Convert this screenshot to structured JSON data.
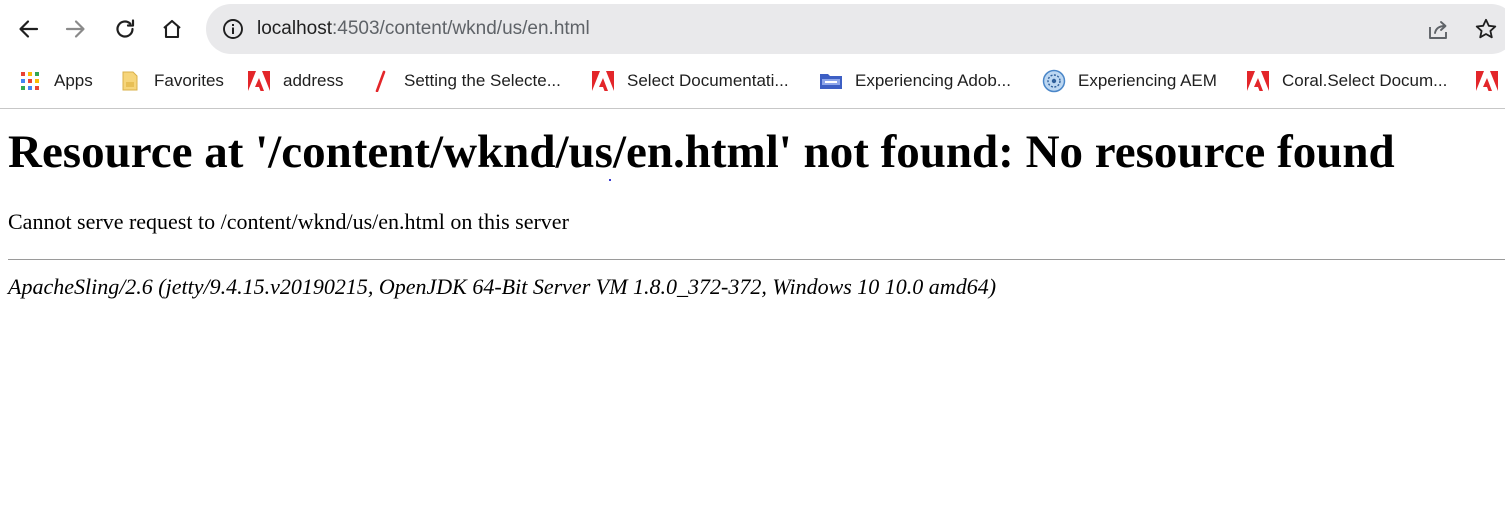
{
  "browser": {
    "address_bar": {
      "host": "localhost",
      "rest": ":4503/content/wknd/us/en.html"
    },
    "icons": {
      "back": "back-arrow-icon",
      "forward": "forward-arrow-icon",
      "reload": "reload-icon",
      "home": "home-icon",
      "info": "info-icon",
      "share": "share-icon",
      "bookmark": "star-icon"
    },
    "bookmarks": [
      {
        "label": "Apps",
        "icon": "apps-grid-icon"
      },
      {
        "label": "Favorites",
        "icon": "folder-icon"
      },
      {
        "label": "address",
        "icon": "adobe-icon"
      },
      {
        "label": "Setting the Selecte...",
        "icon": "slash-icon"
      },
      {
        "label": "Select Documentati...",
        "icon": "adobe-icon"
      },
      {
        "label": "Experiencing Adob...",
        "icon": "rss-folder-icon"
      },
      {
        "label": "Experiencing AEM",
        "icon": "globe-icon"
      },
      {
        "label": "Coral.Select Docum...",
        "icon": "adobe-icon"
      },
      {
        "label": "",
        "icon": "adobe-icon"
      }
    ]
  },
  "page": {
    "title": "Resource at '/content/wknd/us/en.html' not found: No resource found",
    "message": "Cannot serve request to /content/wknd/us/en.html on this server",
    "signature": "ApacheSling/2.6 (jetty/9.4.15.v20190215, OpenJDK 64-Bit Server VM 1.8.0_372-372, Windows 10 10.0 amd64)"
  },
  "colors": {
    "adobe_red": "#e3262a",
    "omnibox_bg": "#e9e9eb",
    "icon_dark": "#1f1f1f",
    "icon_muted": "#5f6368"
  }
}
